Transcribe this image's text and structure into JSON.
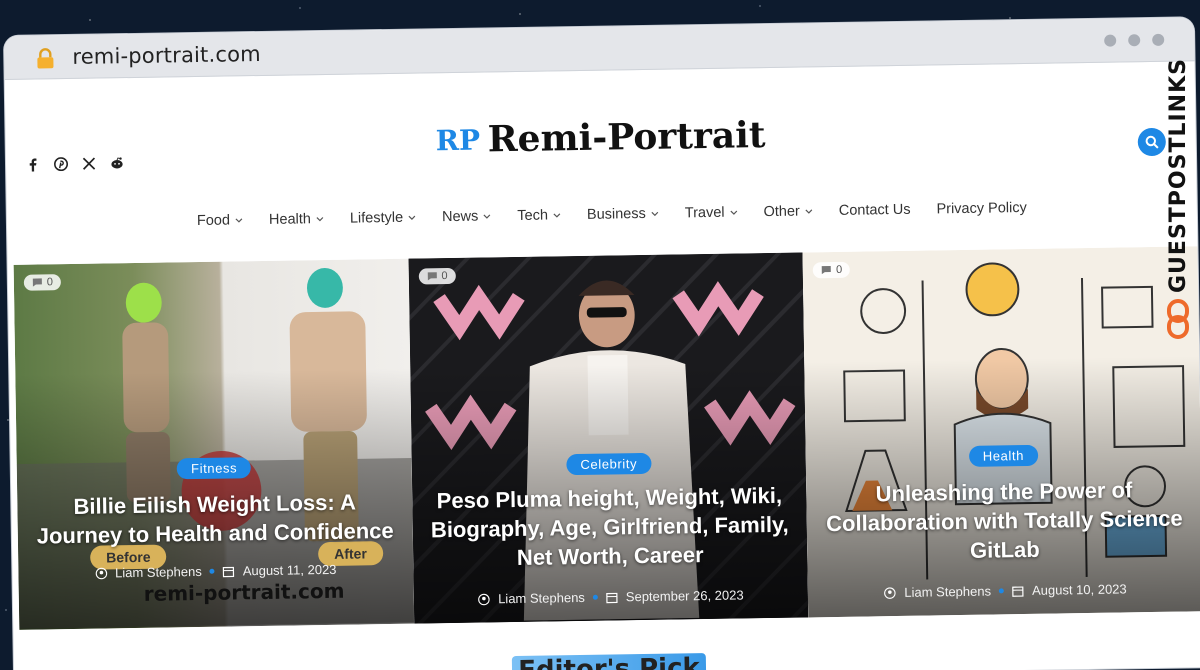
{
  "browser": {
    "url": "remi-portrait.com",
    "lock_icon": "lock-icon"
  },
  "site": {
    "logo_text": "Remi-Portrait",
    "logo_mark": "RP"
  },
  "social": [
    "facebook-icon",
    "pinterest-icon",
    "x-icon",
    "reddit-icon"
  ],
  "nav": {
    "items": [
      {
        "label": "Food",
        "dropdown": true
      },
      {
        "label": "Health",
        "dropdown": true
      },
      {
        "label": "Lifestyle",
        "dropdown": true
      },
      {
        "label": "News",
        "dropdown": true
      },
      {
        "label": "Tech",
        "dropdown": true
      },
      {
        "label": "Business",
        "dropdown": true
      },
      {
        "label": "Travel",
        "dropdown": true
      },
      {
        "label": "Other",
        "dropdown": true
      },
      {
        "label": "Contact Us",
        "dropdown": false
      },
      {
        "label": "Privacy Policy",
        "dropdown": false
      }
    ]
  },
  "hero": {
    "cards": [
      {
        "comments": "0",
        "category": "Fitness",
        "title": "Billie Eilish Weight Loss: A Journey to Health and Confidence",
        "author": "Liam Stephens",
        "date": "August 11, 2023",
        "before_label": "Before",
        "after_label": "After",
        "watermark": "remi-portrait.com"
      },
      {
        "comments": "0",
        "category": "Celebrity",
        "title": "Peso Pluma height, Weight, Wiki, Biography, Age, Girlfriend, Family, Net Worth, Career",
        "author": "Liam Stephens",
        "date": "September 26, 2023"
      },
      {
        "comments": "0",
        "category": "Health",
        "title": "Unleashing the Power of Collaboration with Totally Science GitLab",
        "author": "Liam Stephens",
        "date": "August 10, 2023"
      }
    ]
  },
  "section": {
    "editors_pick": "Editor's Pick"
  },
  "badge": {
    "text": "GUESTPOSTLINKS"
  },
  "colors": {
    "accent": "#1e88e5",
    "chrome": "#e4e6ea"
  }
}
